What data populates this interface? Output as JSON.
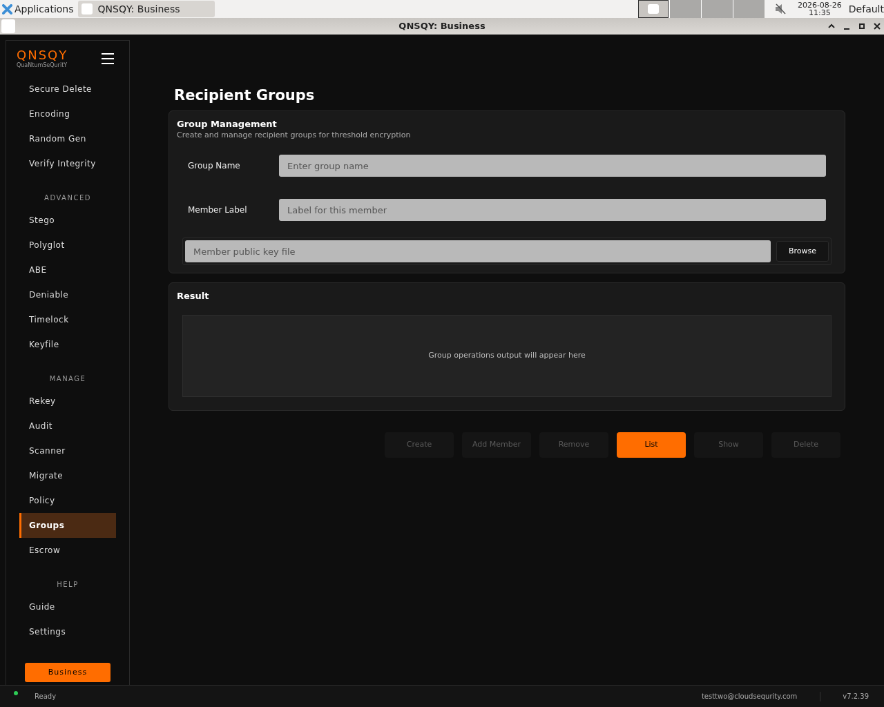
{
  "taskbar": {
    "applications": "Applications",
    "task": "QNSQY: Business",
    "date": "2026-08-26",
    "time": "11:35",
    "user": "Default"
  },
  "window": {
    "title": "QNSQY: Business"
  },
  "sidebar": {
    "logo": {
      "name": "QNSQY",
      "tagline": "QuaNtumSeQuritY"
    },
    "sections": [
      {
        "items": [
          {
            "label": "Secure Delete",
            "selected": false
          },
          {
            "label": "Encoding",
            "selected": false
          },
          {
            "label": "Random Gen",
            "selected": false
          },
          {
            "label": "Verify Integrity",
            "selected": false
          }
        ]
      },
      {
        "heading": "ADVANCED",
        "items": [
          {
            "label": "Stego",
            "selected": false
          },
          {
            "label": "Polyglot",
            "selected": false
          },
          {
            "label": "ABE",
            "selected": false
          },
          {
            "label": "Deniable",
            "selected": false
          },
          {
            "label": "Timelock",
            "selected": false
          },
          {
            "label": "Keyfile",
            "selected": false
          }
        ]
      },
      {
        "heading": "MANAGE",
        "items": [
          {
            "label": "Rekey",
            "selected": false
          },
          {
            "label": "Audit",
            "selected": false
          },
          {
            "label": "Scanner",
            "selected": false
          },
          {
            "label": "Migrate",
            "selected": false
          },
          {
            "label": "Policy",
            "selected": false
          },
          {
            "label": "Groups",
            "selected": true
          },
          {
            "label": "Escrow",
            "selected": false
          }
        ]
      },
      {
        "heading": "HELP",
        "items": [
          {
            "label": "Guide",
            "selected": false
          },
          {
            "label": "Settings",
            "selected": false
          }
        ]
      }
    ],
    "edition_button": "Business"
  },
  "page": {
    "title": "Recipient Groups",
    "management": {
      "title": "Group Management",
      "subtitle": "Create and manage recipient groups for threshold encryption",
      "fields": [
        {
          "label": "Group Name",
          "placeholder": "Enter group name"
        },
        {
          "label": "Member Label",
          "placeholder": "Label for this member"
        }
      ],
      "file_field": {
        "placeholder": "Member public key file",
        "button": "Browse"
      }
    },
    "result": {
      "title": "Result",
      "placeholder": "Group operations output will appear here"
    },
    "actions": [
      {
        "label": "Create",
        "disabled": true
      },
      {
        "label": "Add Member",
        "disabled": true
      },
      {
        "label": "Remove",
        "disabled": true
      },
      {
        "label": "List",
        "disabled": false
      },
      {
        "label": "Show",
        "disabled": true
      },
      {
        "label": "Delete",
        "disabled": true
      }
    ]
  },
  "status_bar": {
    "status": "Ready",
    "user": "testtwo@cloudsequrity.com",
    "version": "v7.2.39"
  }
}
